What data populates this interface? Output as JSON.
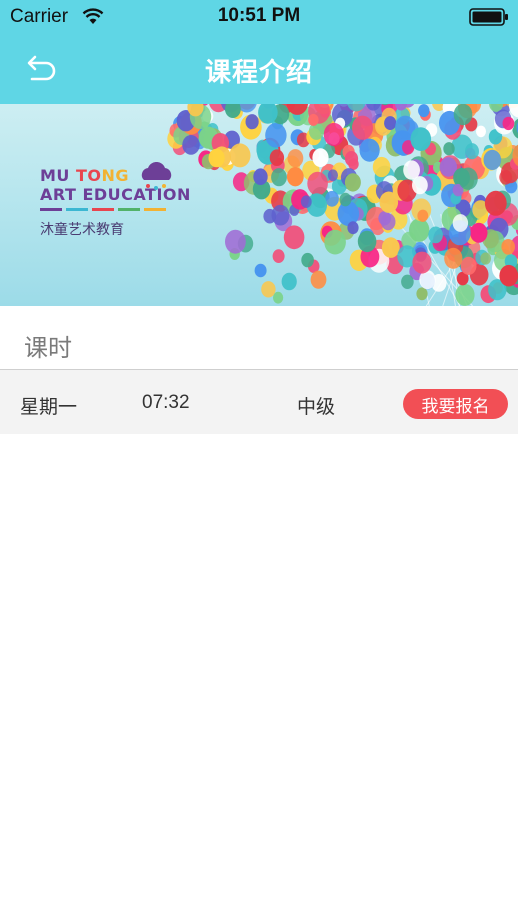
{
  "status_bar": {
    "carrier": "Carrier",
    "time": "10:51 PM"
  },
  "nav": {
    "title": "课程介绍",
    "back_icon": "back-arrow-icon"
  },
  "banner": {
    "logo_line1": "MU TONG",
    "logo_line2": "ART EDUCATION",
    "logo_cn": "沐童艺术教育"
  },
  "section": {
    "title": "课时"
  },
  "schedule": [
    {
      "day": "星期一",
      "time": "07:32",
      "level": "中级",
      "action": "我要报名"
    }
  ],
  "colors": {
    "header": "#5fd6e5",
    "enroll_button": "#f24f55"
  }
}
